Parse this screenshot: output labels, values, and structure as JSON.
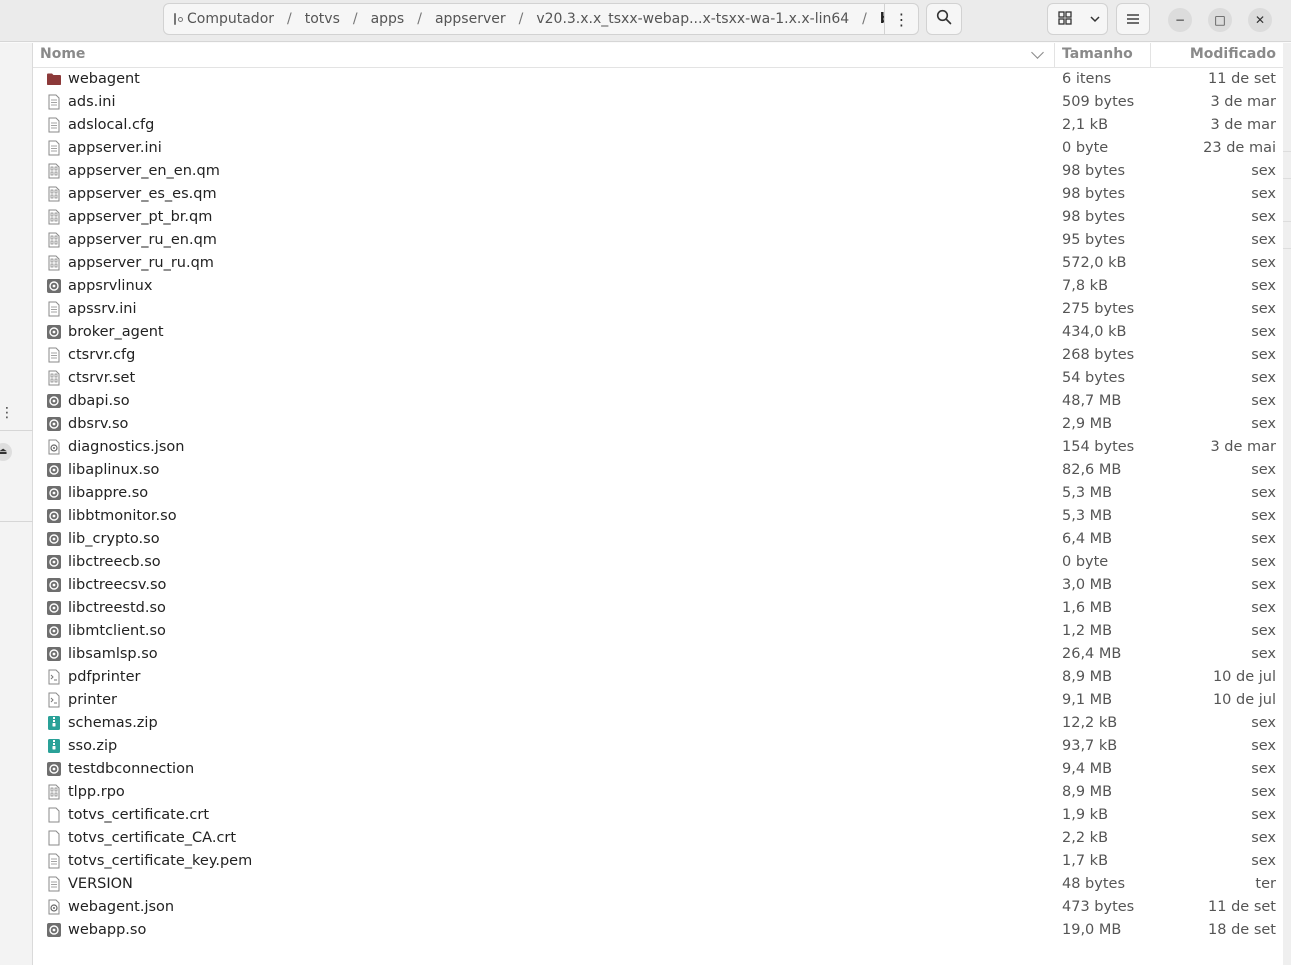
{
  "header": {
    "path": [
      "Computador",
      "totvs",
      "apps",
      "appserver",
      "v20.3.x.x_tsxx-webap...x-tsxx-wa-1.x.x-lin64",
      "bin"
    ],
    "path_menu_icon": "vertical-dots-icon",
    "search_icon": "search-icon",
    "view_icon": "grid-view-icon",
    "view_dropdown_icon": "chevron-down-icon",
    "menu_icon": "hamburger-icon",
    "minimize_glyph": "−",
    "maximize_glyph": "□",
    "close_glyph": "✕"
  },
  "sidebar": {
    "dots": "⋮",
    "eject_glyph": "⏏"
  },
  "columns": {
    "name": "Nome",
    "size": "Tamanho",
    "modified": "Modificado"
  },
  "colors": {
    "folder": "#8c3a3a",
    "archive": "#2aa198"
  },
  "files": [
    {
      "name": "webagent",
      "size": "6 itens",
      "modified": "11 de set",
      "icon": "folder"
    },
    {
      "name": "ads.ini",
      "size": "509 bytes",
      "modified": "3 de mar",
      "icon": "text"
    },
    {
      "name": "adslocal.cfg",
      "size": "2,1 kB",
      "modified": "3 de mar",
      "icon": "text"
    },
    {
      "name": "appserver.ini",
      "size": "0 byte",
      "modified": "23 de mai",
      "icon": "text"
    },
    {
      "name": "appserver_en_en.qm",
      "size": "98 bytes",
      "modified": "sex",
      "icon": "binary"
    },
    {
      "name": "appserver_es_es.qm",
      "size": "98 bytes",
      "modified": "sex",
      "icon": "binary"
    },
    {
      "name": "appserver_pt_br.qm",
      "size": "98 bytes",
      "modified": "sex",
      "icon": "binary"
    },
    {
      "name": "appserver_ru_en.qm",
      "size": "95 bytes",
      "modified": "sex",
      "icon": "binary"
    },
    {
      "name": "appserver_ru_ru.qm",
      "size": "572,0 kB",
      "modified": "sex",
      "icon": "binary"
    },
    {
      "name": "appsrvlinux",
      "size": "7,8 kB",
      "modified": "sex",
      "icon": "executable"
    },
    {
      "name": "apssrv.ini",
      "size": "275 bytes",
      "modified": "sex",
      "icon": "text"
    },
    {
      "name": "broker_agent",
      "size": "434,0 kB",
      "modified": "sex",
      "icon": "executable"
    },
    {
      "name": "ctsrvr.cfg",
      "size": "268 bytes",
      "modified": "sex",
      "icon": "text"
    },
    {
      "name": "ctsrvr.set",
      "size": "54 bytes",
      "modified": "sex",
      "icon": "binary"
    },
    {
      "name": "dbapi.so",
      "size": "48,7 MB",
      "modified": "sex",
      "icon": "executable"
    },
    {
      "name": "dbsrv.so",
      "size": "2,9 MB",
      "modified": "sex",
      "icon": "executable"
    },
    {
      "name": "diagnostics.json",
      "size": "154 bytes",
      "modified": "3 de mar",
      "icon": "json"
    },
    {
      "name": "libaplinux.so",
      "size": "82,6 MB",
      "modified": "sex",
      "icon": "executable"
    },
    {
      "name": "libappre.so",
      "size": "5,3 MB",
      "modified": "sex",
      "icon": "executable"
    },
    {
      "name": "libbtmonitor.so",
      "size": "5,3 MB",
      "modified": "sex",
      "icon": "executable"
    },
    {
      "name": "lib_crypto.so",
      "size": "6,4 MB",
      "modified": "sex",
      "icon": "executable"
    },
    {
      "name": "libctreecb.so",
      "size": "0 byte",
      "modified": "sex",
      "icon": "executable"
    },
    {
      "name": "libctreecsv.so",
      "size": "3,0 MB",
      "modified": "sex",
      "icon": "executable"
    },
    {
      "name": "libctreestd.so",
      "size": "1,6 MB",
      "modified": "sex",
      "icon": "executable"
    },
    {
      "name": "libmtclient.so",
      "size": "1,2 MB",
      "modified": "sex",
      "icon": "executable"
    },
    {
      "name": "libsamlsp.so",
      "size": "26,4 MB",
      "modified": "sex",
      "icon": "executable"
    },
    {
      "name": "pdfprinter",
      "size": "8,9 MB",
      "modified": "10 de jul",
      "icon": "script"
    },
    {
      "name": "printer",
      "size": "9,1 MB",
      "modified": "10 de jul",
      "icon": "script"
    },
    {
      "name": "schemas.zip",
      "size": "12,2 kB",
      "modified": "sex",
      "icon": "archive"
    },
    {
      "name": "sso.zip",
      "size": "93,7 kB",
      "modified": "sex",
      "icon": "archive"
    },
    {
      "name": "testdbconnection",
      "size": "9,4 MB",
      "modified": "sex",
      "icon": "executable"
    },
    {
      "name": "tlpp.rpo",
      "size": "8,9 MB",
      "modified": "sex",
      "icon": "binary"
    },
    {
      "name": "totvs_certificate.crt",
      "size": "1,9 kB",
      "modified": "sex",
      "icon": "blank"
    },
    {
      "name": "totvs_certificate_CA.crt",
      "size": "2,2 kB",
      "modified": "sex",
      "icon": "blank"
    },
    {
      "name": "totvs_certificate_key.pem",
      "size": "1,7 kB",
      "modified": "sex",
      "icon": "text"
    },
    {
      "name": "VERSION",
      "size": "48 bytes",
      "modified": "ter",
      "icon": "text"
    },
    {
      "name": "webagent.json",
      "size": "473 bytes",
      "modified": "11 de set",
      "icon": "json"
    },
    {
      "name": "webapp.so",
      "size": "19,0 MB",
      "modified": "18 de set",
      "icon": "executable"
    }
  ]
}
